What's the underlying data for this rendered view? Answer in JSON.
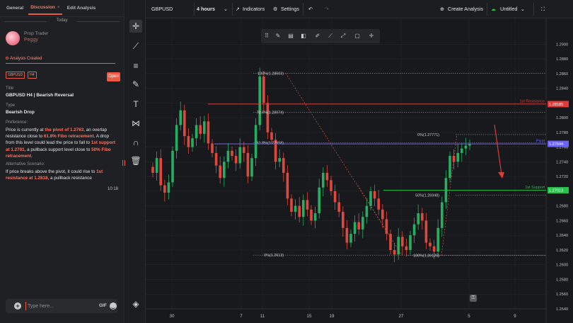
{
  "left_panel": {
    "tabs": [
      {
        "label": "General"
      },
      {
        "label": "Discussion",
        "close": "×"
      },
      {
        "label": "Edit Analysis"
      }
    ],
    "day_label": "Today",
    "author": {
      "role": "Prop Trader",
      "name": "Peggy"
    },
    "created_label": "Analysis Created",
    "tags": [
      "GBPUSD",
      "H4"
    ],
    "open_label": "Open",
    "title_label": "Title",
    "title_value": "GBPUSD H4 | Bearish Reversal",
    "type_label": "Type",
    "type_value": "Bearish Drop",
    "preference_label": "Preference:",
    "preference_parts": [
      {
        "t": "Price is currently at ",
        "h": false
      },
      {
        "t": "the pivot of 1.2763",
        "h": true
      },
      {
        "t": ", an overlap resistance close to ",
        "h": false
      },
      {
        "t": "61.8% Fibo retracement",
        "h": true
      },
      {
        "t": ". A drop from this level could lead the price to fall to ",
        "h": false
      },
      {
        "t": "1st support at 1.2701",
        "h": true
      },
      {
        "t": ", a pullback support level close to ",
        "h": false
      },
      {
        "t": "50% Fibo retracement",
        "h": true
      },
      {
        "t": ".",
        "h": false
      }
    ],
    "alternative_label": "Alternative Scenario:",
    "alternative_parts": [
      {
        "t": "If price breaks above the pivot, it could rise to ",
        "h": false
      },
      {
        "t": "1st resistance at 1.2818",
        "h": true
      },
      {
        "t": ", a pullback resistance",
        "h": false
      }
    ],
    "time": "10:18",
    "input_placeholder": "Type here...",
    "gif_label": "GIF"
  },
  "toolbar": {
    "symbol": "GBPUSD",
    "timeframe": "4 hours",
    "indicators": "Indicators",
    "settings": "Settings",
    "create_analysis": "Create Analysis",
    "untitled": "Untitled"
  },
  "colors": {
    "accent": "#e85a44",
    "resistance": "#e0393a",
    "support": "#27c24c",
    "pivot": "#6c63ff",
    "up_candle": "#27ae60",
    "down_candle": "#e0483d"
  },
  "chart_data": {
    "type": "candlestick",
    "symbol": "GBPUSD",
    "timeframe": "4 hours",
    "x_ticks": [
      "30",
      "7",
      "11",
      "15",
      "19",
      "27",
      "5",
      "9"
    ],
    "ylim": [
      1.254,
      1.2935
    ],
    "y_ticks": [
      "1.2540",
      "1.2560",
      "1.2580",
      "1.2600",
      "1.2620",
      "1.2640",
      "1.2660",
      "1.2680",
      "1.2700",
      "1.2720",
      "1.2740",
      "1.2760",
      "1.2780",
      "1.2800",
      "1.2820",
      "1.2840",
      "1.2860",
      "1.2880",
      "1.2900"
    ],
    "levels": [
      {
        "name": "1st Resistance",
        "value": 1.28185,
        "label": "1.28185",
        "color": "#e0393a"
      },
      {
        "name": "Pivot",
        "value": 1.27644,
        "label": "1.27644",
        "color": "#6c63ff"
      },
      {
        "name": "1st Support",
        "value": 1.27013,
        "label": "1.27013",
        "color": "#27c24c"
      }
    ],
    "fibo_labels": [
      {
        "text": "100%(1.28603)",
        "value": 1.28603
      },
      {
        "text": "78.6%(1.28074)",
        "value": 1.28074
      },
      {
        "text": "61.8%(1.27658)",
        "value": 1.27658
      },
      {
        "text": "0%(1.2613)",
        "value": 1.2613
      },
      {
        "text": "0%(1.27771)",
        "value": 1.27771
      },
      {
        "text": "50%(1.26948)",
        "value": 1.26948
      },
      {
        "text": "100%(1.26126)",
        "value": 1.26126
      }
    ],
    "closes": [
      1.2725,
      1.2745,
      1.2708,
      1.2698,
      1.2712,
      1.2755,
      1.279,
      1.281,
      1.2775,
      1.276,
      1.2772,
      1.279,
      1.2778,
      1.2795,
      1.2765,
      1.2752,
      1.2735,
      1.2718,
      1.274,
      1.2755,
      1.2748,
      1.2738,
      1.276,
      1.2752,
      1.272,
      1.2745,
      1.279,
      1.2856,
      1.282,
      1.278,
      1.277,
      1.274,
      1.2745,
      1.2725,
      1.269,
      1.2672,
      1.268,
      1.2665,
      1.2688,
      1.2675,
      1.266,
      1.267,
      1.2705,
      1.2725,
      1.2715,
      1.27,
      1.2685,
      1.2672,
      1.265,
      1.263,
      1.2642,
      1.2658,
      1.2648,
      1.2665,
      1.268,
      1.27,
      1.269,
      1.2675,
      1.2662,
      1.2642,
      1.262,
      1.2614,
      1.2638,
      1.2625,
      1.262,
      1.264,
      1.2655,
      1.267,
      1.266,
      1.263,
      1.2625,
      1.2618,
      1.265,
      1.2685,
      1.2718,
      1.2748,
      1.274,
      1.2752,
      1.2758,
      1.2762,
      1.2764
    ]
  }
}
